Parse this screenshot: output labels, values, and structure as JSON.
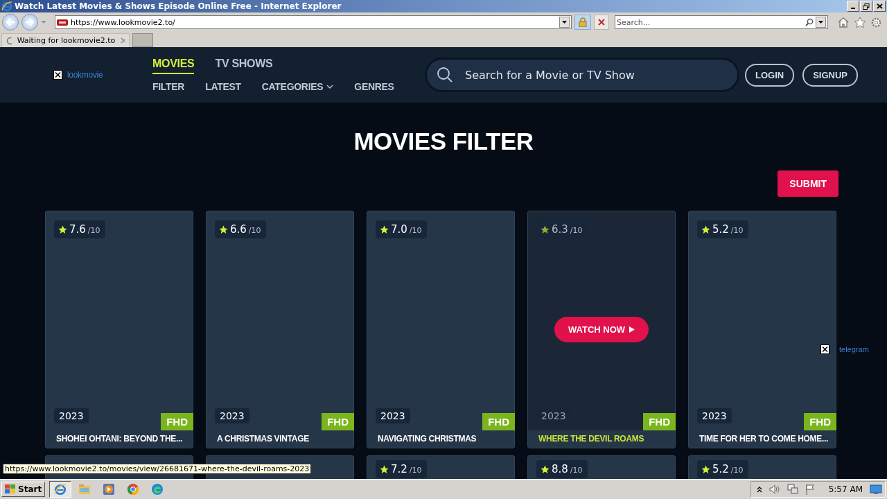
{
  "browser": {
    "title": "Watch Latest Movies & Shows Episode Online Free - Internet Explorer",
    "address": "https://www.lookmovie2.to/",
    "search_placeholder": "Search...",
    "tabs": [
      {
        "label": "Waiting for lookmovie2.to",
        "loading": true,
        "selected": true
      }
    ]
  },
  "header": {
    "logo": "lookmovie",
    "primary_nav": [
      {
        "label": "MOVIES",
        "selected": true
      },
      {
        "label": "TV SHOWS",
        "selected": false
      }
    ],
    "secondary_nav": [
      {
        "label": "FILTER",
        "dropdown": false
      },
      {
        "label": "LATEST",
        "dropdown": false
      },
      {
        "label": "CATEGORIES",
        "dropdown": true
      },
      {
        "label": "GENRES",
        "dropdown": false
      }
    ],
    "search": {
      "placeholder": "Search for a Movie or TV Show"
    },
    "buttons": [
      "LOGIN",
      "SIGNUP"
    ]
  },
  "page": {
    "heading": "MOVIES FILTER",
    "submit": "SUBMIT"
  },
  "movies": [
    {
      "rating": "7.6",
      "scale": "/10",
      "year": "2023",
      "quality": "FHD",
      "title": "SHOHEI OHTANI: BEYOND THE...",
      "hovered": false
    },
    {
      "rating": "6.6",
      "scale": "/10",
      "year": "2023",
      "quality": "FHD",
      "title": "A CHRISTMAS VINTAGE",
      "hovered": false
    },
    {
      "rating": "7.0",
      "scale": "/10",
      "year": "2023",
      "quality": "FHD",
      "title": "NAVIGATING CHRISTMAS",
      "hovered": false
    },
    {
      "rating": "6.3",
      "scale": "/10",
      "year": "2023",
      "quality": "FHD",
      "title": "WHERE THE DEVIL ROAMS",
      "hovered": true,
      "watch_label": "WATCH NOW"
    },
    {
      "rating": "5.2",
      "scale": "/10",
      "year": "2023",
      "quality": "FHD",
      "title": "TIME FOR HER TO COME HOME...",
      "hovered": false
    }
  ],
  "more_movies": [
    {
      "kind": "plain"
    },
    {
      "kind": "plain"
    },
    {
      "kind": "rated",
      "rating": "7.2",
      "scale": "/10"
    },
    {
      "kind": "rated",
      "rating": "8.8",
      "scale": "/10"
    },
    {
      "kind": "rated",
      "rating": "5.2",
      "scale": "/10"
    }
  ],
  "floating_link": {
    "label": "telegram"
  },
  "status_url": "https://www.lookmovie2.to/movies/view/26681671-where-the-devil-roams-2023",
  "taskbar": {
    "start": "Start",
    "clock": "5:57 AM",
    "pinned_apps": [
      {
        "kind": "ie",
        "selected": true
      },
      {
        "kind": "folder",
        "selected": false
      },
      {
        "kind": "media",
        "selected": false
      },
      {
        "kind": "chrome",
        "selected": false
      },
      {
        "kind": "edge",
        "selected": false
      }
    ]
  }
}
